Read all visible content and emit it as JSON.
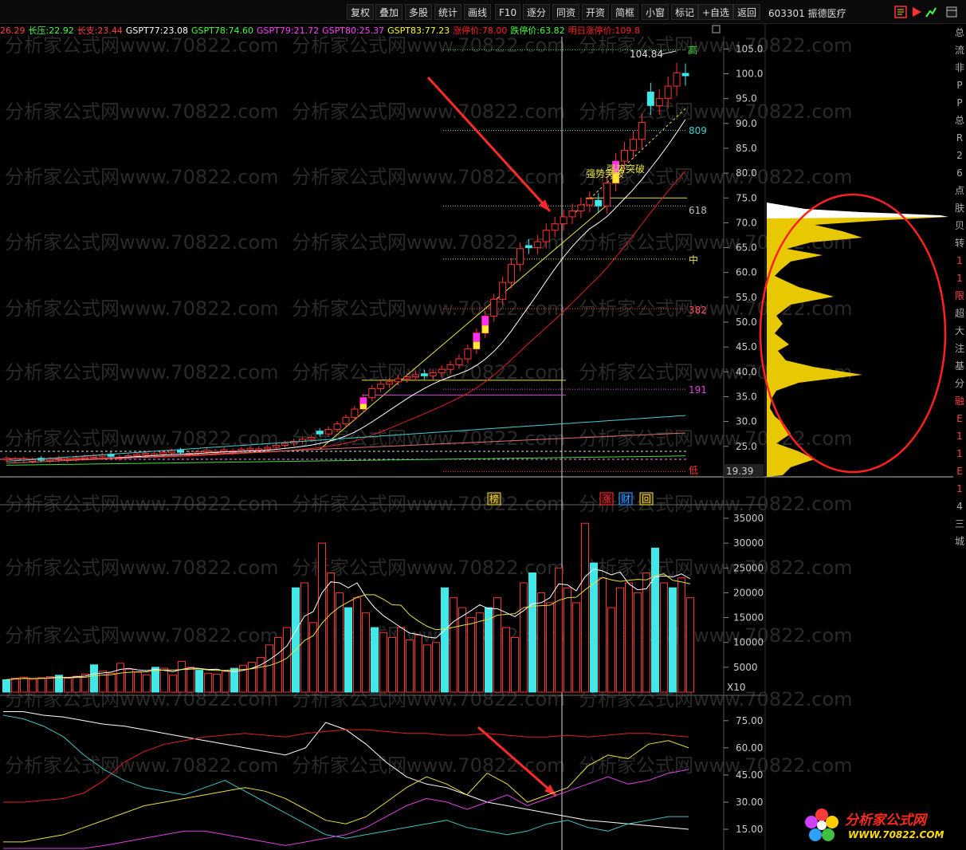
{
  "toolbar": {
    "buttons": [
      "复权",
      "叠加",
      "多股",
      "统计",
      "画线",
      "F10",
      "逐分",
      "同资",
      "开资",
      "简框",
      "小窗",
      "标记",
      "+自选",
      "返回"
    ]
  },
  "header": {
    "stock_code": "603301",
    "stock_name": "振德医疗"
  },
  "indicators": [
    {
      "label": "",
      "value": "26.29",
      "color": "#ff4040"
    },
    {
      "label": "长压:",
      "value": "22.92",
      "color": "#40ff40"
    },
    {
      "label": "长支:",
      "value": "23.44",
      "color": "#ff4040"
    },
    {
      "label": "GSPT77:",
      "value": "23.08",
      "color": "#ffffff"
    },
    {
      "label": "GSPT78:",
      "value": "74.60",
      "color": "#40ff40"
    },
    {
      "label": "GSPT79:",
      "value": "21.72",
      "color": "#ff40ff"
    },
    {
      "label": "GSPT80:",
      "value": "25.37",
      "color": "#ff40ff"
    },
    {
      "label": "GSPT83:",
      "value": "77.23",
      "color": "#ffff00"
    },
    {
      "label": "涨停价:",
      "value": "78.00",
      "color": "#ff2020"
    },
    {
      "label": "跌停价:",
      "value": "63.82",
      "color": "#40ff40"
    },
    {
      "label": "明日涨停价:",
      "value": "109.8",
      "color": "#ff2020"
    }
  ],
  "price_axis": [
    "105.0",
    "100.0",
    "95.0",
    "90.0",
    "85.0",
    "80.0",
    "75.0",
    "70.0",
    "65.0",
    "60.0",
    "55.0",
    "50.0",
    "45.0",
    "40.0",
    "35.0",
    "30.0",
    "25.0"
  ],
  "price_low_label": "19.39",
  "annotations": {
    "high_value": "104.84",
    "high_marker": "高",
    "low_marker": "低",
    "mid_marker": "中",
    "fib_809": "809",
    "fib_618": "618",
    "fib_382": "382",
    "fib_191": "191",
    "breakout_1": "强势突破",
    "breakout_2": "强势突破",
    "tag_list": "榜",
    "tag_limit": "涨",
    "tag_finance": "财",
    "tag_return": "回"
  },
  "volume_axis": [
    "35000",
    "30000",
    "25000",
    "20000",
    "15000",
    "10000",
    "5000"
  ],
  "volume_unit": "X10",
  "osc_axis": [
    "75.00",
    "60.00",
    "45.00",
    "30.00",
    "15.00"
  ],
  "side_chars": [
    "总",
    "流",
    "非",
    "P",
    "P",
    "总",
    "R",
    "2",
    "6",
    "点",
    "肤",
    "贝",
    "转",
    "1",
    "1",
    "限",
    "超",
    "大",
    "注",
    "基",
    "分",
    "融",
    "E",
    "1",
    "1",
    "E",
    "1",
    "4",
    "三",
    "城"
  ],
  "logo": {
    "name": "分析家公式网",
    "url": "WWW.70822.COM"
  },
  "watermark": "分析家公式网www.70822.com",
  "colors": {
    "up": "#ff3030",
    "down": "#40e8e8",
    "ma_white": "#ffffff",
    "ma_red": "#e02020",
    "ma_cyan": "#40d0d0",
    "ma_yellow": "#e8e040",
    "ma_pink": "#e040e0",
    "profile": "#e8c800"
  }
}
